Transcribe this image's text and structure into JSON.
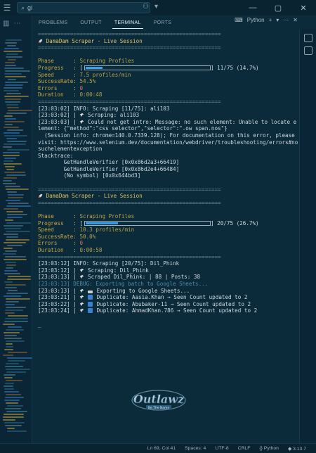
{
  "search": {
    "value": "gi"
  },
  "panel_tabs": [
    "PROBLEMS",
    "OUTPUT",
    "TERMINAL",
    "PORTS"
  ],
  "panel": {
    "shell_label": "Python",
    "add_label": "+"
  },
  "terminal": {
    "separator": "=========================================================",
    "sessions": [
      {
        "title": "DamaDam Scraper - Live Session",
        "phase_label": "Phase",
        "phase": "Scraping Profiles",
        "progress_label": "Progress",
        "progress_fraction": 0.147,
        "progress_text": "11/75 (14.7%)",
        "speed_label": "Speed",
        "speed": "7.5 profiles/min",
        "success_label": "SuccessRate",
        "success": "54.5%",
        "errors_label": "Errors",
        "errors": "0",
        "duration_label": "Duration",
        "duration": "0:00:48"
      },
      {
        "title": "DamaDam Scraper - Live Session",
        "phase_label": "Phase",
        "phase": "Scraping Profiles",
        "progress_label": "Progress",
        "progress_fraction": 0.267,
        "progress_text": "20/75 (26.7%)",
        "speed_label": "Speed",
        "speed": "10.3 profiles/min",
        "success_label": "SuccessRate",
        "success": "50.0%",
        "errors_label": "Errors",
        "errors": "0",
        "duration_label": "Duration",
        "duration": "0:00:58"
      }
    ],
    "log1": {
      "l1": "[23:03:02] INFO: Scraping [11/75]: ali103",
      "l2": "[23:03:02] | ",
      "l2b": " Scraping: ali103",
      "l3": "[23:03:03] | ",
      "l3b": " Could not get intro: Message: no such element: Unable to locate element: {\"method\":\"css selector\",\"selector\":\".ow span.nos\"}",
      "l4": "  (Session info: chrome=140.0.7339.128); For documentation on this error, please visit: https://www.selenium.dev/documentation/webdriver/troubleshooting/errors#nosuchelementexception",
      "l5": "Stacktrace:",
      "l6": "        GetHandleVerifier [0x0x86d2a3+66419]",
      "l7": "        GetHandleVerifier [0x0x86d2e4+66484]",
      "l8": "        (No symbol) [0x0x644bd3]"
    },
    "log2": {
      "l1": "[23:03:12] INFO: Scraping [20/75]: Dil_Phink",
      "l2": "[23:03:12] | ",
      "l2b": " Scraping: Dil_Phink",
      "l3": "[23:03:13] | ",
      "l3b": " Scraped Dil_Phink: | 88 | Posts: 38",
      "l4": "[23:03:13] DEBUG: Exporting batch to Google Sheets...",
      "l5": "[23:03:13] | ",
      "l5b": " Exporting to Google Sheets...",
      "l6": "[23:03:21] | ",
      "l6b": " Duplicate: Aasia.Khan → Seen Count updated to 2",
      "l7": "[23:03:22] | ",
      "l7b": " Duplicate: Abubaker-11 → Seen Count updated to 2",
      "l8": "[23:03:24] | ",
      "l8b": " Duplicate: AhmadKhan.786 → Seen Count updated to 2",
      "cursor": "_"
    }
  },
  "watermark": {
    "text": "Outlawz",
    "tagline": "Be The Name"
  },
  "status": {
    "position": "Ln 69, Col 41",
    "spaces": "Spaces: 4",
    "encoding": "UTF-8",
    "eol": "CRLF",
    "language": "Python",
    "version": "3.13.7"
  },
  "colors": {
    "background": "#0b2b3a",
    "progress_fill": "#3aa0e8",
    "accent_yellow": "#e2c064",
    "label_gold": "#c9a53f"
  }
}
